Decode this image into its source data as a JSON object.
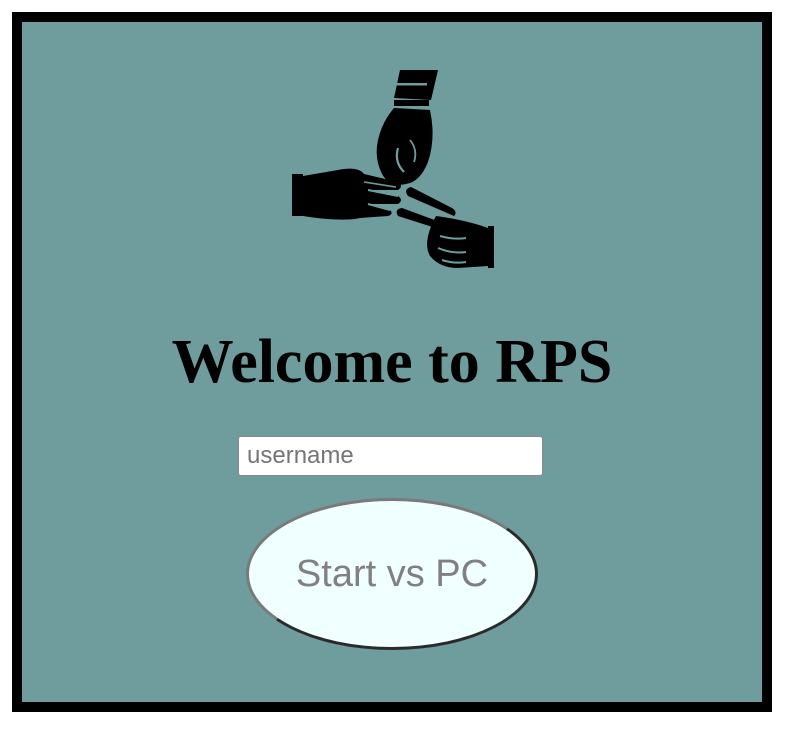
{
  "logo": {
    "icon": "rock-paper-scissors-hands-icon"
  },
  "heading": {
    "title": "Welcome to RPS"
  },
  "form": {
    "username_placeholder": "username",
    "username_value": "",
    "start_label": "Start vs PC"
  },
  "colors": {
    "background": "#6f9c9c",
    "border": "#000000",
    "button_fill": "#f0ffff",
    "button_text": "#808080"
  }
}
